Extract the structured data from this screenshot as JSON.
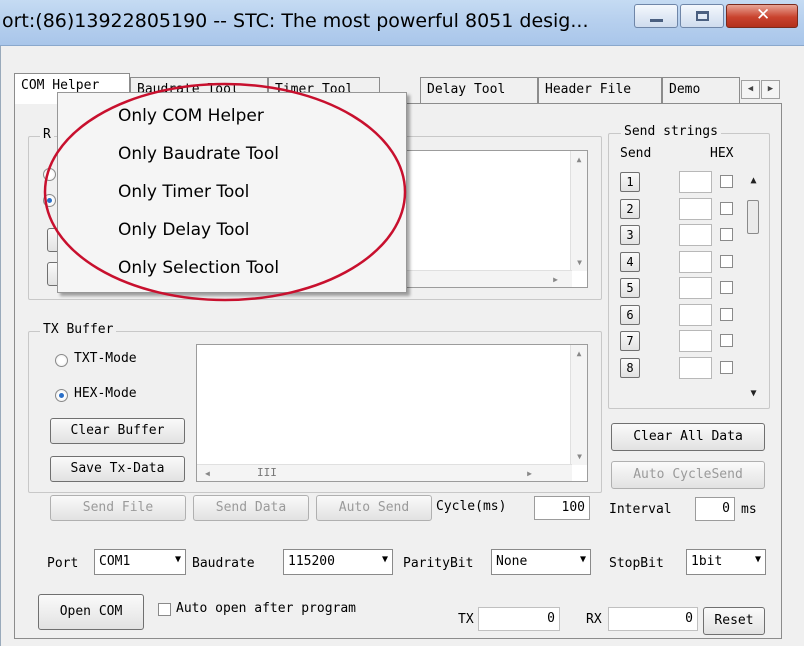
{
  "window": {
    "title": "ort:(86)13922805190  -- STC: The most powerful 8051 desig..."
  },
  "tabs": [
    {
      "label": "COM Helper"
    },
    {
      "label": "Baudrate Tool"
    },
    {
      "label": "Timer Tool"
    },
    {
      "label": "Delay Tool"
    },
    {
      "label": "Header File"
    },
    {
      "label": "Demo"
    }
  ],
  "rx_group": {
    "label": "R"
  },
  "context_menu": {
    "items": [
      {
        "label": "Only COM Helper"
      },
      {
        "label": "Only Baudrate Tool"
      },
      {
        "label": "Only Timer Tool"
      },
      {
        "label": "Only Delay Tool"
      },
      {
        "label": "Only Selection Tool"
      }
    ]
  },
  "tx_buffer": {
    "label": "TX Buffer",
    "txt_mode": "TXT-Mode",
    "hex_mode": "HEX-Mode",
    "selected_mode": "HEX-Mode",
    "clear_buffer": "Clear Buffer",
    "save_tx_data": "Save Tx-Data",
    "scroll_thumb": "III"
  },
  "actions": {
    "send_file": "Send File",
    "send_data": "Send Data",
    "auto_send": "Auto Send",
    "cycle_label": "Cycle(ms)",
    "cycle_value": "100"
  },
  "send_strings": {
    "label": "Send strings",
    "col_send": "Send",
    "col_hex": "HEX",
    "rows": [
      "1",
      "2",
      "3",
      "4",
      "5",
      "6",
      "7",
      "8"
    ],
    "clear_all": "Clear All Data",
    "auto_cycle": "Auto CycleSend",
    "interval_label": "Interval",
    "interval_value": "0",
    "interval_unit": "ms"
  },
  "serial": {
    "port_label": "Port",
    "port_value": "COM1",
    "baud_label": "Baudrate",
    "baud_value": "115200",
    "parity_label": "ParityBit",
    "parity_value": "None",
    "stop_label": "StopBit",
    "stop_value": "1bit"
  },
  "bottom": {
    "open_com": "Open COM",
    "auto_open": "Auto open after program",
    "tx_label": "TX",
    "tx_value": "0",
    "rx_label": "RX",
    "rx_value": "0",
    "reset": "Reset"
  },
  "colors": {
    "accent": "#2a6fc8",
    "annotation_ellipse": "#c8102e"
  }
}
